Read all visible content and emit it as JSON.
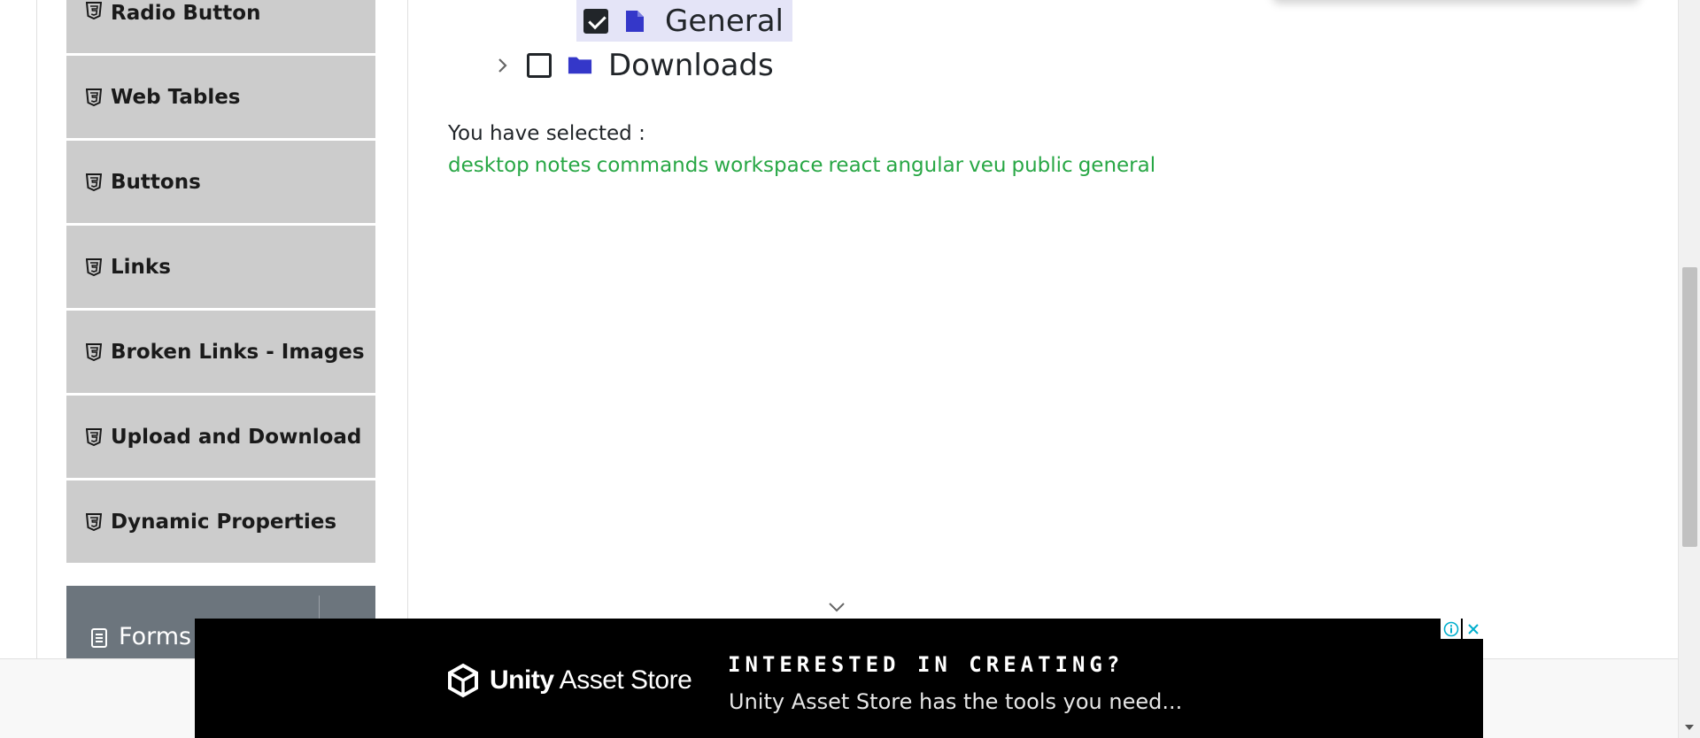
{
  "sidebar": {
    "items": [
      {
        "label": "Radio Button"
      },
      {
        "label": "Web Tables"
      },
      {
        "label": "Buttons"
      },
      {
        "label": "Links"
      },
      {
        "label": "Broken Links - Images"
      },
      {
        "label": "Upload and Download"
      },
      {
        "label": "Dynamic Properties"
      }
    ],
    "group": {
      "label": "Forms"
    }
  },
  "tree": {
    "nodes": [
      {
        "label": "General",
        "checked": true,
        "icon": "file-icon"
      },
      {
        "label": "Downloads",
        "checked": false,
        "icon": "folder-icon"
      }
    ]
  },
  "result": {
    "prefix": "You have selected :",
    "selected": [
      "desktop",
      "notes",
      "commands",
      "workspace",
      "react",
      "angular",
      "veu",
      "public",
      "general"
    ]
  },
  "ad": {
    "brand_bold": "Unity",
    "brand_rest": " Asset Store",
    "headline": "INTERESTED IN CREATING?",
    "subline": "Unity Asset Store has the tools you need..."
  },
  "colors": {
    "sidebar_bg": "#cccccc",
    "group_header_bg": "#6c757d",
    "selected_text": "#28a745",
    "tree_highlight": "#e4e4f7",
    "tree_icon": "#3437c9"
  }
}
